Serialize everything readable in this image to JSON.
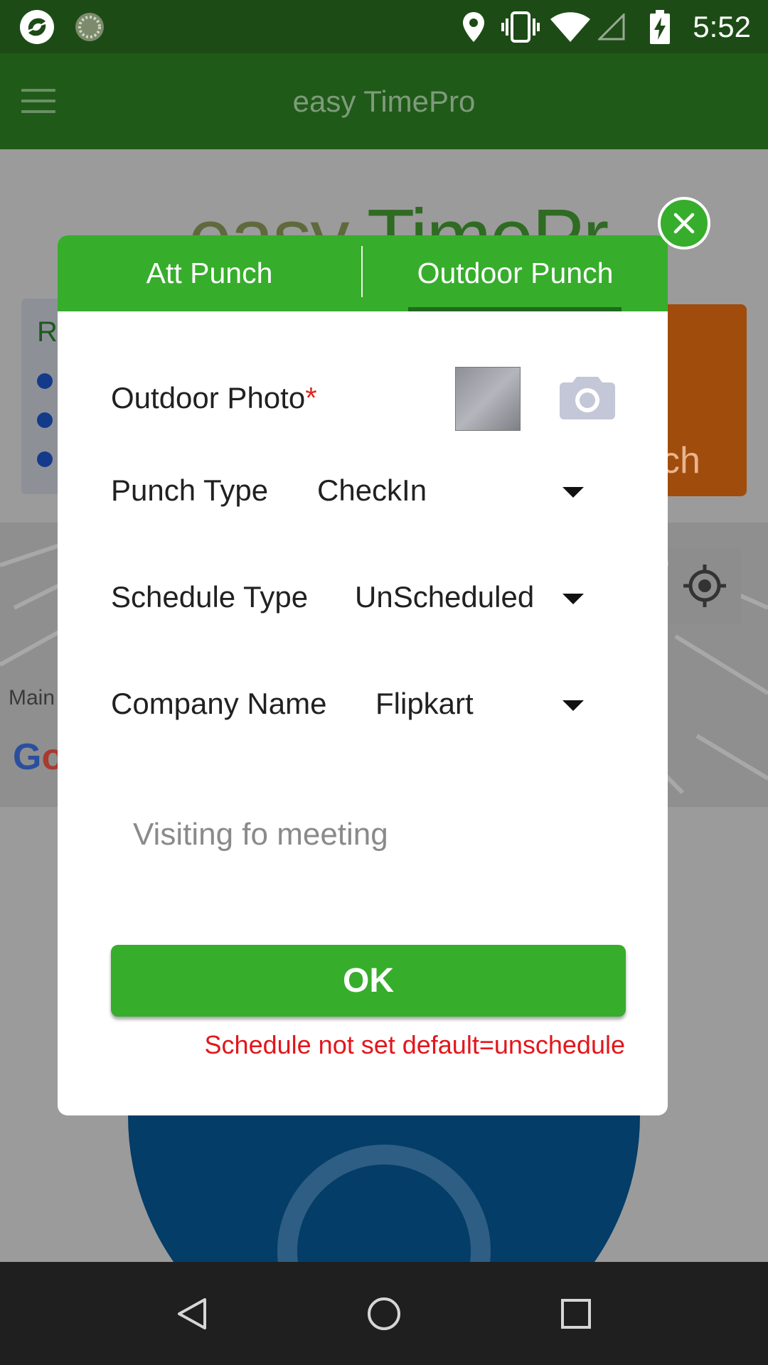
{
  "status_bar": {
    "time": "5:52"
  },
  "app_bar": {
    "title": "easy TimePro"
  },
  "background": {
    "logo_part1": "easy ",
    "logo_part2": "TimePr",
    "card_letter": "R",
    "orange_text": "ch",
    "map_label": "Main",
    "google_g": "G",
    "google_o": "o"
  },
  "dialog": {
    "tabs": [
      {
        "label": "Att Punch",
        "active": false
      },
      {
        "label": "Outdoor Punch",
        "active": true
      }
    ],
    "outdoor_photo": {
      "label": "Outdoor Photo",
      "required_mark": "*"
    },
    "punch_type": {
      "label": "Punch Type",
      "value": "CheckIn"
    },
    "schedule_type": {
      "label": "Schedule Type",
      "value": "UnScheduled"
    },
    "company_name": {
      "label": "Company Name",
      "value": "Flipkart"
    },
    "remark": {
      "value": "Visiting fo meeting"
    },
    "ok_button": "OK",
    "error": "Schedule not set default=unschedule"
  },
  "colors": {
    "accent_green": "#37ad2c",
    "error_red": "#e3161b",
    "status_bar": "#1d4b16"
  }
}
